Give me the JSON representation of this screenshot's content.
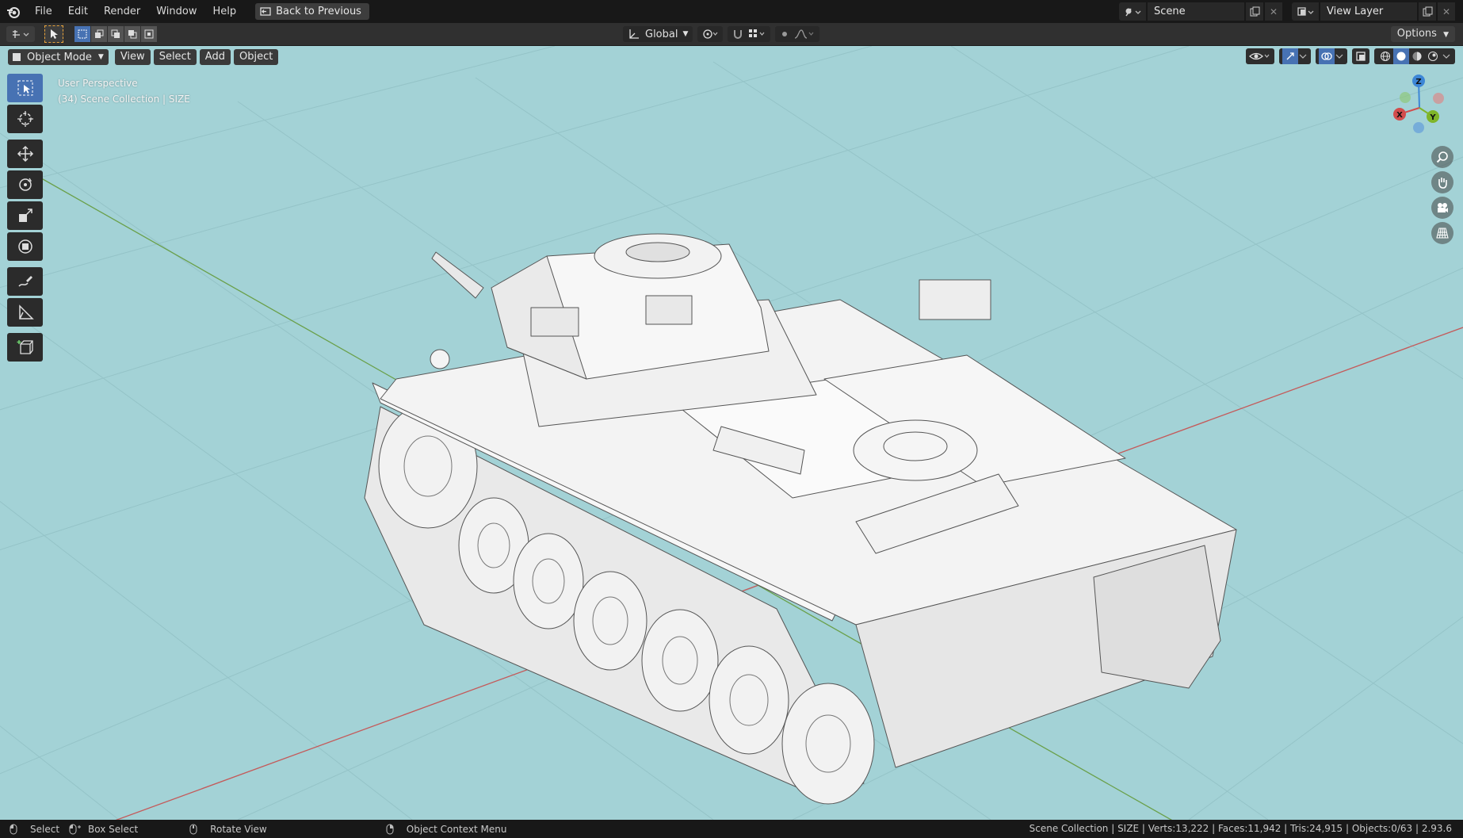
{
  "menu": {
    "items": [
      "File",
      "Edit",
      "Render",
      "Window",
      "Help"
    ],
    "back_button": "Back to Previous"
  },
  "scene": {
    "label": "Scene"
  },
  "view_layer": {
    "label": "View Layer"
  },
  "tool_header": {
    "transform_orientation": "Global",
    "options_label": "Options"
  },
  "viewport": {
    "mode": "Object Mode",
    "menus": [
      "View",
      "Select",
      "Add",
      "Object"
    ],
    "perspective_label": "User Perspective",
    "collection_label": "(34) Scene Collection | SIZE",
    "background_color": "#a3d2d6",
    "x_axis_color": "#c45a5a",
    "y_axis_color": "#6aa04a"
  },
  "gizmo": {
    "z": "Z",
    "y": "Y",
    "x": "X"
  },
  "status": {
    "select": "Select",
    "box_select": "Box Select",
    "rotate_view": "Rotate View",
    "context_menu": "Object Context Menu",
    "stats": "Scene Collection | SIZE | Verts:13,222 | Faces:11,942 | Tris:24,915 | Objects:0/63 | 2.93.6"
  }
}
